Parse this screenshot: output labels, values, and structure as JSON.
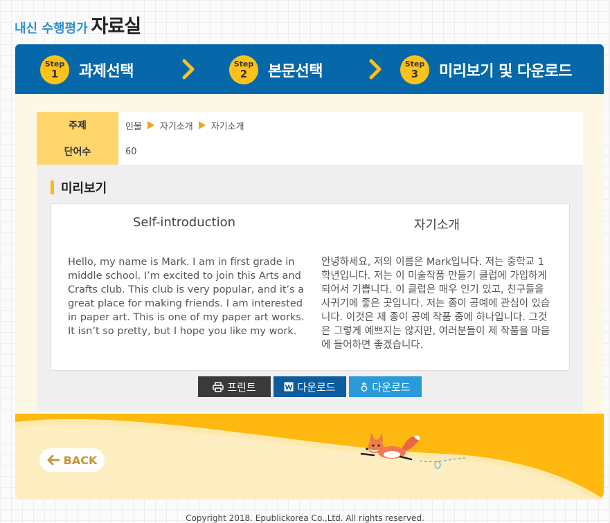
{
  "header": {
    "subtitle": "내신 수행평가",
    "title": "자료실"
  },
  "steps": [
    {
      "word": "Step",
      "num": "1",
      "label": "과제선택"
    },
    {
      "word": "Step",
      "num": "2",
      "label": "본문선택"
    },
    {
      "word": "Step",
      "num": "3",
      "label": "미리보기 및 다운로드"
    }
  ],
  "info": {
    "topic_label": "주제",
    "topic_path": [
      "인물",
      "자기소개",
      "자기소개"
    ],
    "words_label": "단어수",
    "words_value": "60"
  },
  "preview": {
    "title": "미리보기",
    "en_title": "Self-introduction",
    "en_text": "Hello, my name is Mark. I am in first grade in middle school. I’m excited to join this Arts and Crafts club. This club is very popular, and it’s a great place for making friends. I am interested in paper art. This is one of my paper art works. It isn’t so pretty, but I hope you like my work.",
    "ko_title": "자기소개",
    "ko_text": "안녕하세요, 저의 이름은 Mark입니다. 저는 중학교 1학년입니다. 저는 이 미술작품 만들기 클럽에 가입하게 되어서 기쁩니다. 이 클럽은 매우 인기 있고, 친구들을 사귀기에 좋은 곳입니다. 저는 종이 공예에 관심이 있습니다. 이것은 제 종이 공예 작품 중에 하나입니다. 그것은 그렇게 예쁘지는 않지만, 여러분들이 제 작품을 마음에 들어하면 좋겠습니다."
  },
  "buttons": {
    "print_label": "프린트",
    "word_download_label": "다운로드",
    "hwp_download_label": "다운로드"
  },
  "back_label": "BACK",
  "footer": "Copyright 2018. Epublickorea Co.,Ltd. All rights reserved.",
  "colors": {
    "stepbar": "#0668a8",
    "accent_yellow": "#fcc21c",
    "print_button": "#3a3a3a",
    "word_button": "#0c5c9e",
    "hwp_button": "#2a9ad8"
  },
  "icons": [
    "chevron-right-icon",
    "printer-icon",
    "word-doc-icon",
    "hwp-doc-icon",
    "arrow-left-icon",
    "fox-illustration"
  ]
}
